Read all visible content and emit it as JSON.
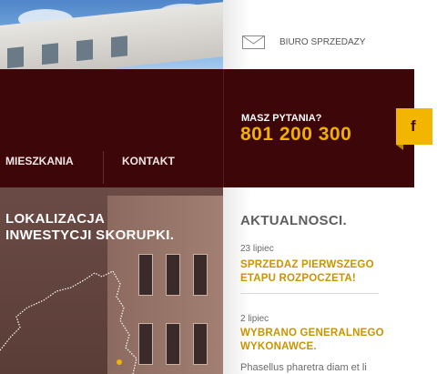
{
  "header": {
    "biuro_label": "BIURO SPRZEDAZY",
    "ask_label": "MASZ PYTANIA?",
    "phone": "801 200 300",
    "facebook_letter": "f"
  },
  "nav": {
    "items": [
      {
        "label": "MIESZKANIA"
      },
      {
        "label": "KONTAKT"
      }
    ]
  },
  "hero": {
    "line1": "LOKALIZACJA",
    "line2": "INWESTYCJI SKORUPKI."
  },
  "news": {
    "title": "AKTUALNOSCI.",
    "items": [
      {
        "date": "23 lipiec",
        "headline1": "SPRZEDAZ PIERWSZEGO",
        "headline2": "ETAPU ROZPOCZETA!"
      },
      {
        "date": "2 lipiec",
        "headline1": "WYBRANO GENERALNEGO",
        "headline2": "WYKONAWCE."
      }
    ],
    "body_snippet": "Phasellus pharetra diam et li"
  },
  "colors": {
    "band": "#3d0608",
    "accent": "#f0b000",
    "news_headline": "#c99400"
  }
}
